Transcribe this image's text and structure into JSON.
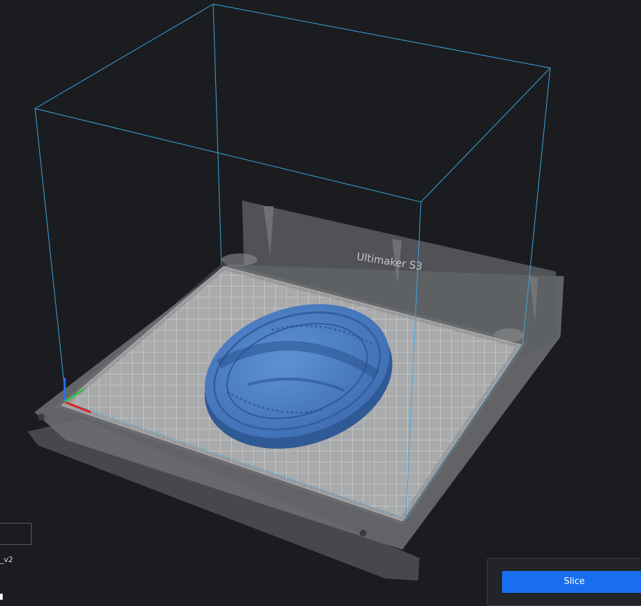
{
  "viewport": {
    "printer_name": "Ultimaker S3",
    "model_color": "#4a7ec4",
    "build_volume_color": "#3aa9e4",
    "axis_colors": {
      "x": "#e02020",
      "y": "#30c040",
      "z": "#2a6cf0"
    }
  },
  "object_list": {
    "name_input_value": "",
    "object_name": "_v2"
  },
  "action_panel": {
    "slice_label": "Slice",
    "slice_color": "#196ef0"
  }
}
